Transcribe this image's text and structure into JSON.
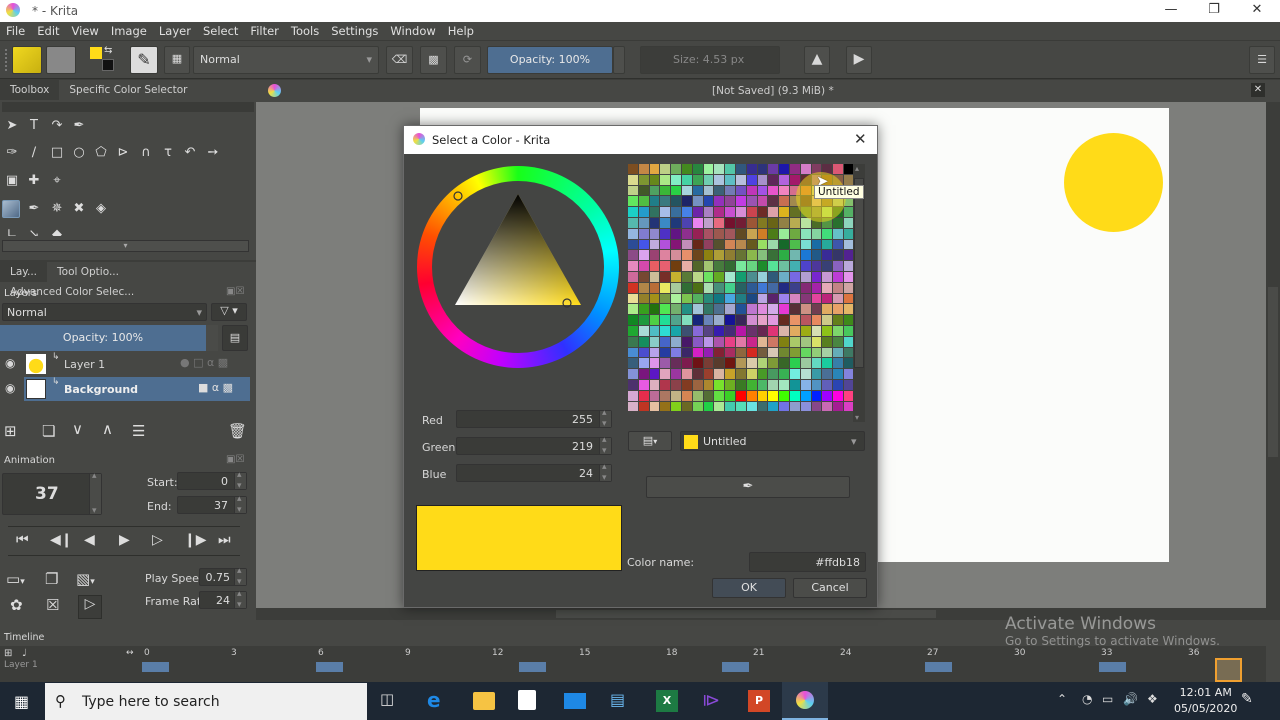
{
  "window": {
    "title": "* - Krita",
    "controls": [
      "minimize",
      "restore",
      "close"
    ]
  },
  "menubar": [
    "File",
    "Edit",
    "View",
    "Image",
    "Layer",
    "Select",
    "Filter",
    "Tools",
    "Settings",
    "Window",
    "Help"
  ],
  "toolbar": {
    "blend_mode": "Normal",
    "opacity_label": "Opacity: 100%",
    "size_label": "Size: 4.53 px",
    "foreground_color": "#ffdb18",
    "background_color": "#111111"
  },
  "document": {
    "status": "[Not Saved]  (9.3 MiB) *"
  },
  "toolbox": {
    "tabs": [
      "Toolbox",
      "Specific Color Selector"
    ],
    "active_tab": "Toolbox"
  },
  "layers_docker": {
    "tabs": [
      "Lay...",
      "Tool Optio...",
      "Advanced Color Selec..."
    ],
    "title": "Layers",
    "blend_mode": "Normal",
    "opacity_label": "Opacity:  100%",
    "layers": [
      {
        "name": "Layer 1",
        "thumb": "yellow-circle",
        "selected": false
      },
      {
        "name": "Background",
        "thumb": "white",
        "selected": true
      }
    ]
  },
  "animation": {
    "title": "Animation",
    "current_frame": "37",
    "start_label": "Start:",
    "start": "0",
    "end_label": "End:",
    "end": "37",
    "play_speed_label": "Play Speed:",
    "play_speed": "0.75",
    "frame_rate_label": "Frame Rate:",
    "frame_rate": "24"
  },
  "timeline": {
    "title": "Timeline",
    "layer_name": "Layer 1",
    "ticks": [
      "0",
      "3",
      "6",
      "9",
      "12",
      "15",
      "18",
      "21",
      "24",
      "27",
      "30",
      "33",
      "36"
    ],
    "keyframes": [
      0,
      6,
      13,
      20,
      27,
      33
    ],
    "current_frame": 37
  },
  "color_dialog": {
    "title": "Select a Color - Krita",
    "red_label": "Red",
    "red": "255",
    "green_label": "Green",
    "green": "219",
    "blue_label": "Blue",
    "blue": "24",
    "current_color": "#ffdb18",
    "palette_name": "Untitled",
    "tooltip": "Untitled",
    "color_name_label": "Color name:",
    "color_name": "#ffdb18",
    "ok_label": "OK",
    "cancel_label": "Cancel"
  },
  "canvas": {
    "shape_color": "#ffdb18"
  },
  "watermark": {
    "line1": "Activate Windows",
    "line2": "Go to Settings to activate Windows."
  },
  "taskbar": {
    "search_placeholder": "Type here to search",
    "time": "12:01 AM",
    "date": "05/05/2020",
    "apps": [
      "task-view",
      "edge",
      "file-explorer",
      "store",
      "mail",
      "network-app",
      "excel",
      "visual-studio",
      "powerpoint",
      "krita"
    ]
  }
}
